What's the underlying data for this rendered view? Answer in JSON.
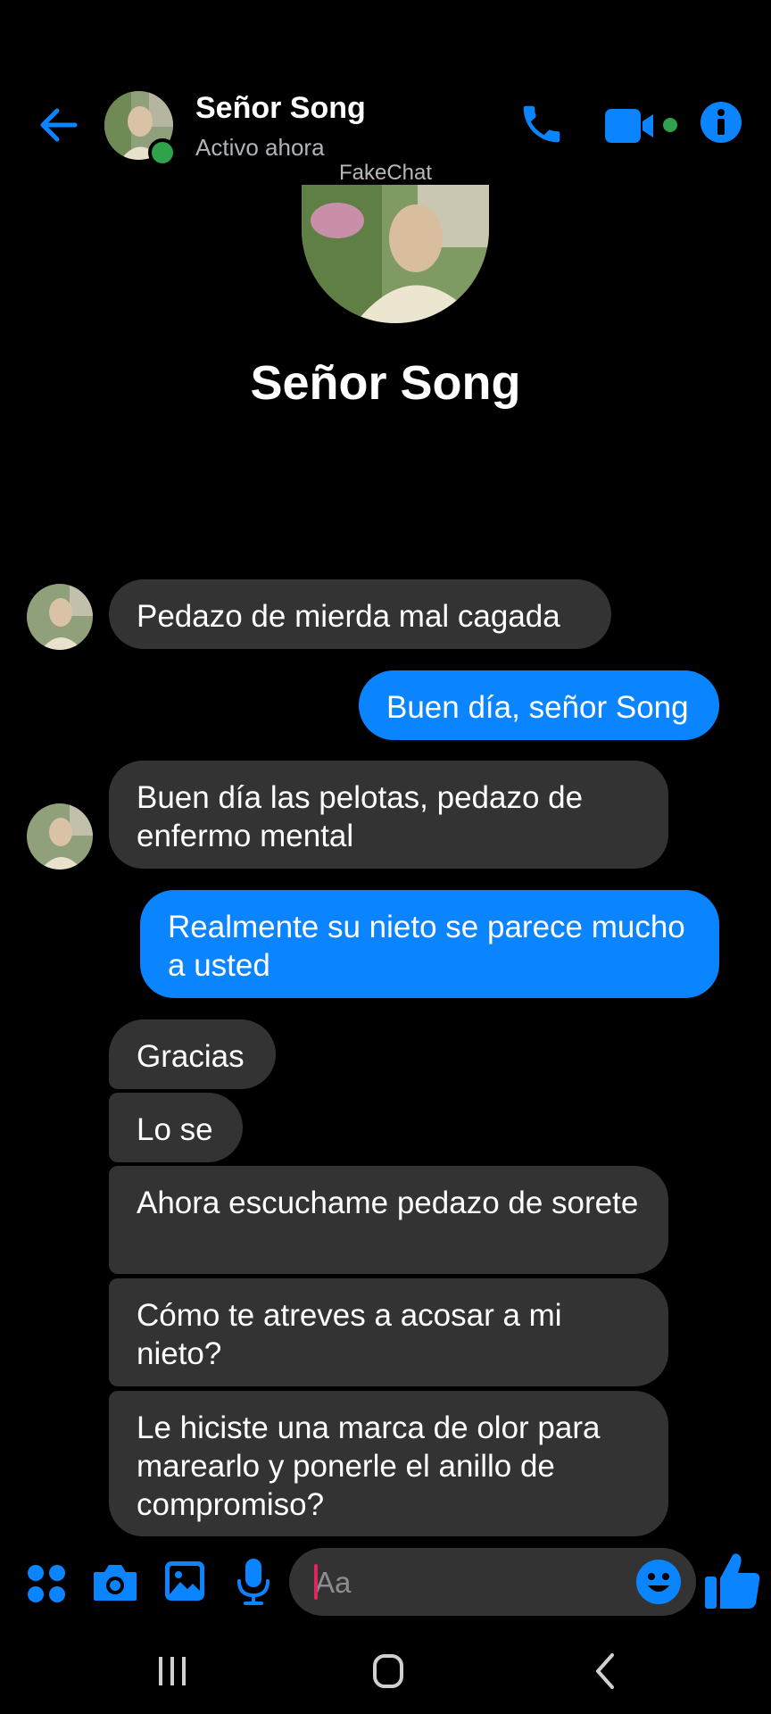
{
  "header": {
    "contact_name": "Señor Song",
    "status": "Activo ahora"
  },
  "watermark": "FakeChat",
  "profile": {
    "name": "Señor Song"
  },
  "messages": [
    {
      "direction": "incoming",
      "text": "Pedazo de mierda mal cagada"
    },
    {
      "direction": "outgoing",
      "text": "Buen día, señor Song"
    },
    {
      "direction": "incoming",
      "text": "Buen día las pelotas, pedazo de enfermo mental"
    },
    {
      "direction": "outgoing",
      "text": "Realmente su nieto se parece mucho a usted"
    },
    {
      "direction": "incoming",
      "text": "Gracias"
    },
    {
      "direction": "incoming",
      "text": "Lo se"
    },
    {
      "direction": "incoming",
      "text": "Ahora escuchame pedazo de sorete"
    },
    {
      "direction": "incoming",
      "text": "Cómo te atreves a acosar a mi nieto?"
    },
    {
      "direction": "incoming",
      "text": "Le hiciste una marca de olor para marearlo y ponerle el anillo de compromiso?"
    }
  ],
  "composer": {
    "placeholder": "Aa"
  },
  "icons": {
    "back": "arrow-left-icon",
    "call": "phone-icon",
    "video": "video-camera-icon",
    "info": "info-icon",
    "apps": "four-dots-icon",
    "camera": "camera-icon",
    "gallery": "image-icon",
    "voice": "microphone-icon",
    "emoji": "smiley-icon",
    "like": "thumbs-up-icon"
  },
  "colors": {
    "accent": "#0a84ff",
    "incoming_bubble": "#333333",
    "background": "#000000",
    "online": "#31a24c"
  }
}
